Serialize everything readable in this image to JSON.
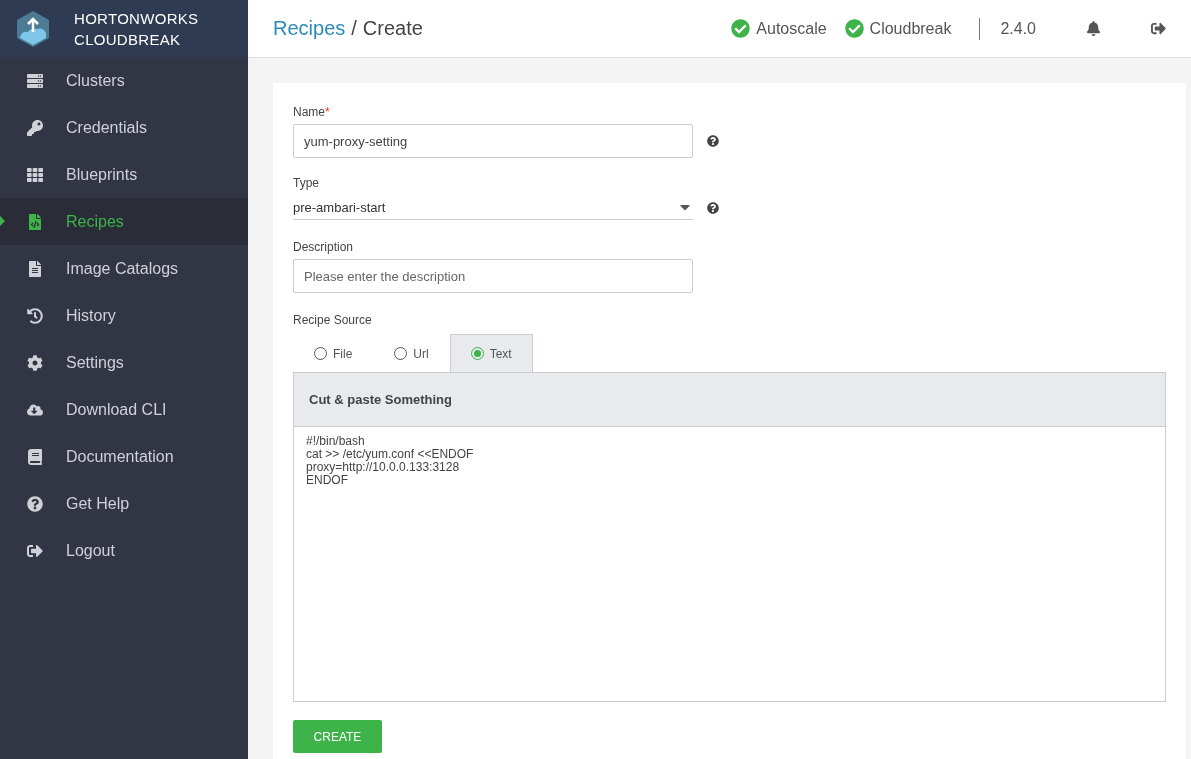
{
  "brand": {
    "line_1": "HORTONWORKS",
    "line_2": "CLOUDBREAK"
  },
  "sidebar": {
    "items": [
      {
        "label": "Clusters",
        "selected": false
      },
      {
        "label": "Credentials",
        "selected": false
      },
      {
        "label": "Blueprints",
        "selected": false
      },
      {
        "label": "Recipes",
        "selected": true
      },
      {
        "label": "Image Catalogs",
        "selected": false
      },
      {
        "label": "History",
        "selected": false
      },
      {
        "label": "Settings",
        "selected": false
      },
      {
        "label": "Download CLI",
        "selected": false
      },
      {
        "label": "Documentation",
        "selected": false
      },
      {
        "label": "Get Help",
        "selected": false
      },
      {
        "label": "Logout",
        "selected": false
      }
    ]
  },
  "header": {
    "breadcrumb_link": "Recipes",
    "separator": "/",
    "page_title": "Create",
    "services": [
      {
        "name": "Autoscale",
        "ok": true
      },
      {
        "name": "Cloudbreak",
        "ok": true
      }
    ],
    "version": "2.4.0"
  },
  "form": {
    "name": {
      "label": "Name",
      "required_mark": "*",
      "value": "yum-proxy-setting"
    },
    "type": {
      "label": "Type",
      "value": "pre-ambari-start"
    },
    "description": {
      "label": "Description",
      "placeholder": "Please enter the description"
    },
    "recipe_source": {
      "label": "Recipe Source",
      "options": [
        {
          "label": "File",
          "selected": false
        },
        {
          "label": "Url",
          "selected": false
        },
        {
          "label": "Text",
          "selected": true
        }
      ],
      "panel_title": "Cut & paste Something",
      "content": "#!/bin/bash\ncat >> /etc/yum.conf <<ENDOF\nproxy=http://10.0.0.133:3128\nENDOF"
    },
    "submit": "CREATE"
  }
}
